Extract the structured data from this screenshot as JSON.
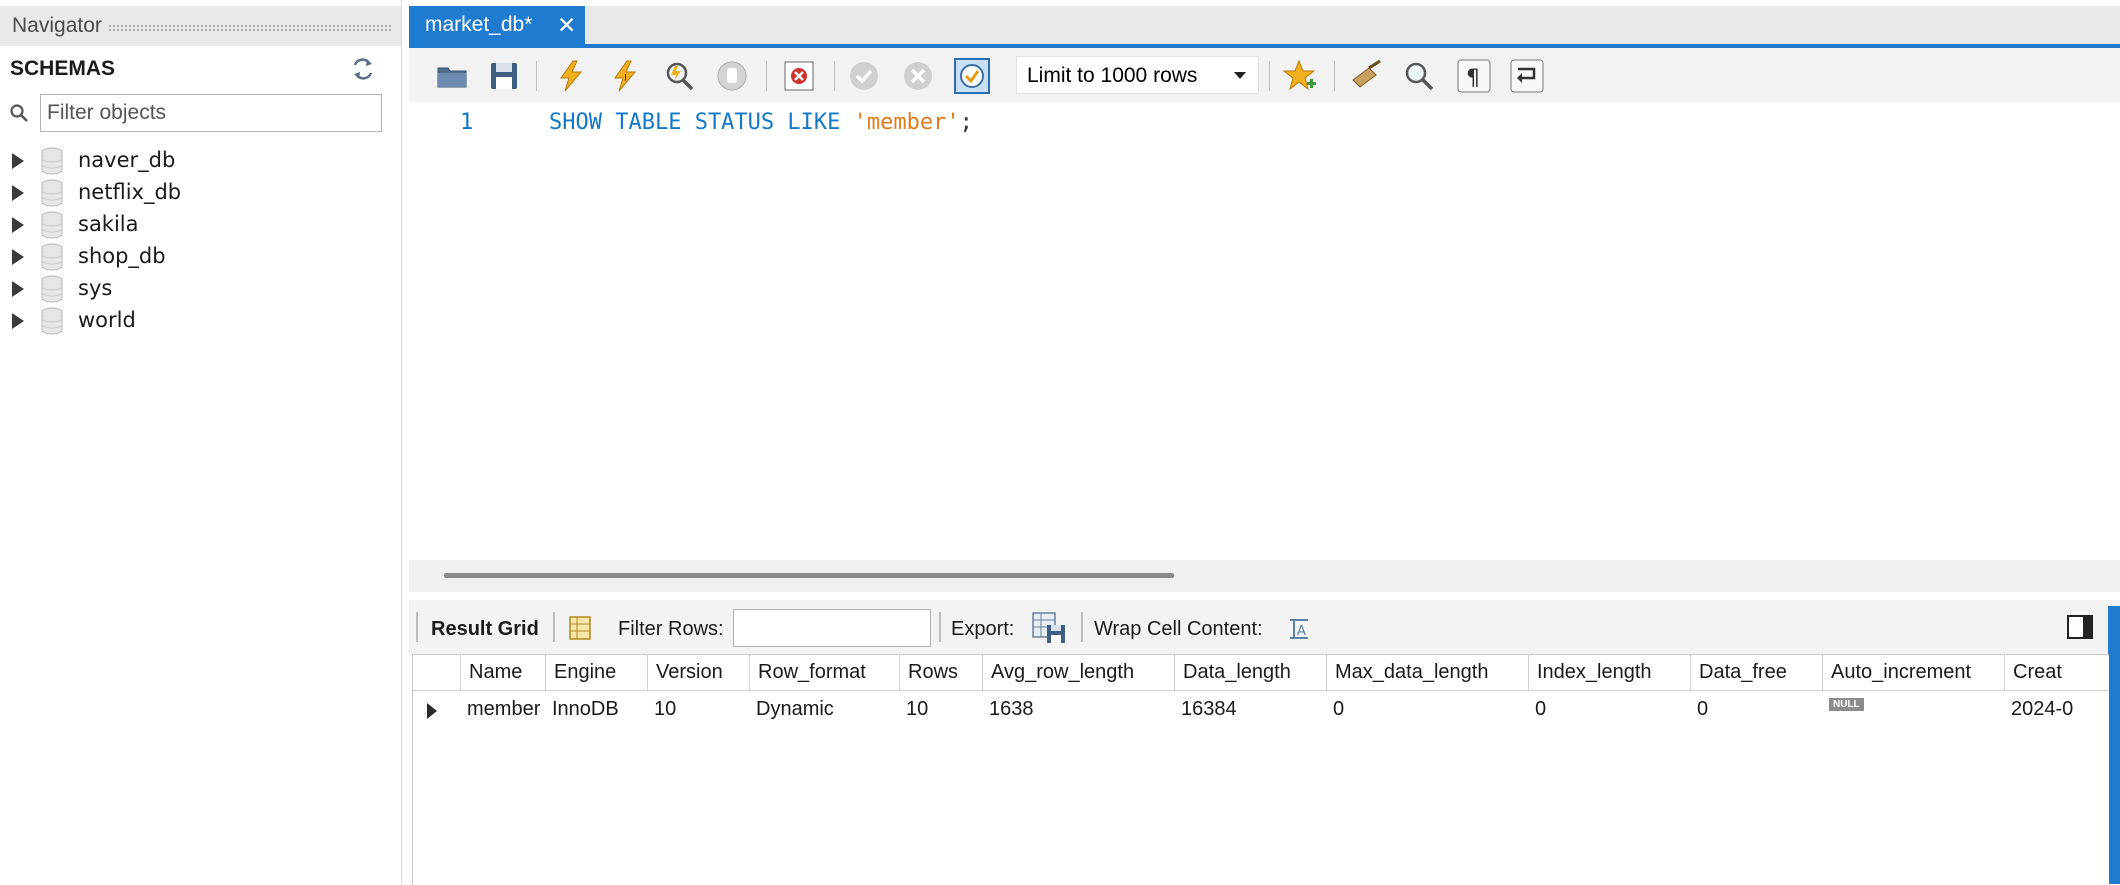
{
  "navigator": {
    "title": "Navigator",
    "schemas_label": "SCHEMAS",
    "filter_placeholder": "Filter objects",
    "schemas": [
      "naver_db",
      "netflix_db",
      "sakila",
      "shop_db",
      "sys",
      "world"
    ]
  },
  "editor": {
    "tab_label": "market_db*",
    "tab_close": "✕",
    "limit_label": "Limit to 1000 rows",
    "line_number": "1",
    "sql": {
      "keywords": "SHOW TABLE STATUS LIKE",
      "string": "'member'",
      "terminator": ";"
    }
  },
  "toolbar_icons": [
    "open-folder-icon",
    "save-icon",
    "execute-icon",
    "execute-current-icon",
    "explain-icon",
    "stop-icon",
    "toggle-error-icon",
    "commit-icon",
    "rollback-icon",
    "autocommit-icon",
    "bookmark-icon",
    "beautify-icon",
    "find-icon",
    "invisible-chars-icon",
    "wrap-lines-icon"
  ],
  "result": {
    "result_grid_label": "Result Grid",
    "filter_rows_label": "Filter Rows:",
    "export_label": "Export:",
    "wrap_label": "Wrap Cell Content:",
    "columns": [
      "Name",
      "Engine",
      "Version",
      "Row_format",
      "Rows",
      "Avg_row_length",
      "Data_length",
      "Max_data_length",
      "Index_length",
      "Data_free",
      "Auto_increment",
      "Creat"
    ],
    "rows": [
      {
        "cells": [
          "member",
          "InnoDB",
          "10",
          "Dynamic",
          "10",
          "1638",
          "16384",
          "0",
          "0",
          "0",
          "NULL",
          "2024-0"
        ]
      }
    ]
  },
  "colors": {
    "accent": "#1e7bd0",
    "keyword": "#1478c8",
    "string": "#e07b1b",
    "null_badge": "#8c8c8c"
  }
}
